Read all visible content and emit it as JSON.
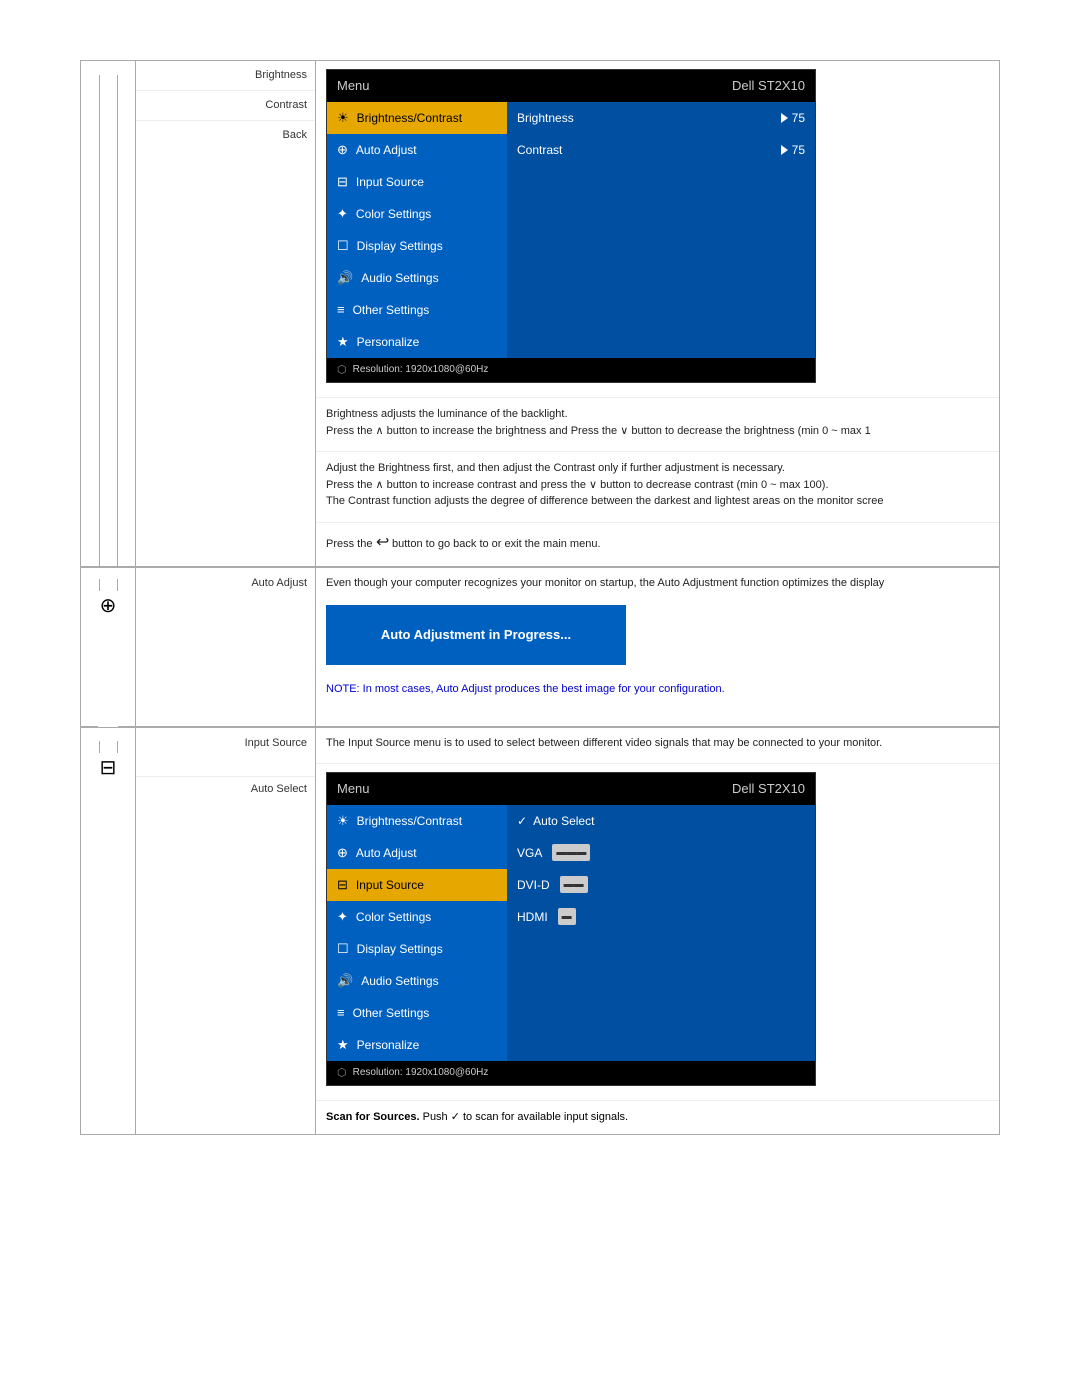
{
  "page": {
    "sections": [
      {
        "id": "brightness-contrast",
        "icon": "☀",
        "icon_label": "brightness-contrast-icon",
        "labels": [
          "Brightness",
          "Contrast",
          "Back"
        ],
        "osd": {
          "header_title": "Menu",
          "header_brand": "Dell ST2X10",
          "rows": [
            {
              "left": "Brightness/Contrast",
              "left_icon": "☀",
              "active": true,
              "right": "Brightness",
              "right_value": "75"
            },
            {
              "left": "Auto Adjust",
              "left_icon": "⊕",
              "active": false,
              "right": "Contrast",
              "right_value": "75"
            },
            {
              "left": "Input Source",
              "left_icon": "⊟",
              "active": false,
              "right": ""
            },
            {
              "left": "Color Settings",
              "left_icon": "⚙",
              "active": false,
              "right": ""
            },
            {
              "left": "Display Settings",
              "left_icon": "☐",
              "active": false,
              "right": ""
            },
            {
              "left": "Audio Settings",
              "left_icon": "🔊",
              "active": false,
              "right": ""
            },
            {
              "left": "Other Settings",
              "left_icon": "≡",
              "active": false,
              "right": ""
            },
            {
              "left": "Personalize",
              "left_icon": "★",
              "active": false,
              "right": ""
            }
          ],
          "footer_text": "Resolution: 1920x1080@60Hz"
        },
        "descriptions": {
          "Brightness": "Brightness adjusts the luminance of the backlight.\nPress the ∧ button to increase the brightness and Press the ∨ button to decrease the brightness (min 0 ~ max 1",
          "Contrast": "Adjust the Brightness first, and then adjust the Contrast only if further adjustment is necessary.\nPress the ∧ button to increase contrast and press the ∨ button to decrease contrast (min 0 ~ max 100).\nThe Contrast function adjusts the degree of difference between the darkest and lightest areas on the monitor scree",
          "Back": "Press the ↺ button to go back to or exit the main menu."
        }
      },
      {
        "id": "auto-adjust",
        "icon": "⊕",
        "icon_label": "auto-adjust-icon",
        "label": "Auto Adjust",
        "description": "Even though your computer recognizes your monitor on startup, the Auto Adjustment function optimizes the display",
        "progress_text": "Auto Adjustment in Progress...",
        "note": "NOTE: In most cases, Auto Adjust produces the best image for your configuration."
      },
      {
        "id": "input-source",
        "icon": "⊟",
        "icon_label": "input-source-icon",
        "label": "Input Source",
        "description": "The Input Source menu is to used to select between different video signals that may be connected to your monitor.",
        "osd": {
          "header_title": "Menu",
          "header_brand": "Dell ST2X10",
          "rows": [
            {
              "left": "Brightness/Contrast",
              "left_icon": "☀",
              "active": false,
              "right": "✓ Auto Select",
              "right_value": ""
            },
            {
              "left": "Auto Adjust",
              "left_icon": "⊕",
              "active": false,
              "right": "VGA",
              "right_connector": "vga"
            },
            {
              "left": "Input Source",
              "left_icon": "⊟",
              "active": true,
              "right": "DVI-D",
              "right_connector": "dvid"
            },
            {
              "left": "Color Settings",
              "left_icon": "⚙",
              "active": false,
              "right": "HDMI",
              "right_connector": "hdmi"
            },
            {
              "left": "Display Settings",
              "left_icon": "☐",
              "active": false,
              "right": ""
            },
            {
              "left": "Audio Settings",
              "left_icon": "🔊",
              "active": false,
              "right": ""
            },
            {
              "left": "Other Settings",
              "left_icon": "≡",
              "active": false,
              "right": ""
            },
            {
              "left": "Personalize",
              "left_icon": "★",
              "active": false,
              "right": ""
            }
          ],
          "footer_text": "Resolution: 1920x1080@60Hz"
        },
        "auto_select_label": "Auto Select",
        "auto_select_desc": "Scan for Sources. Push ✓ to scan for available input signals."
      }
    ]
  }
}
